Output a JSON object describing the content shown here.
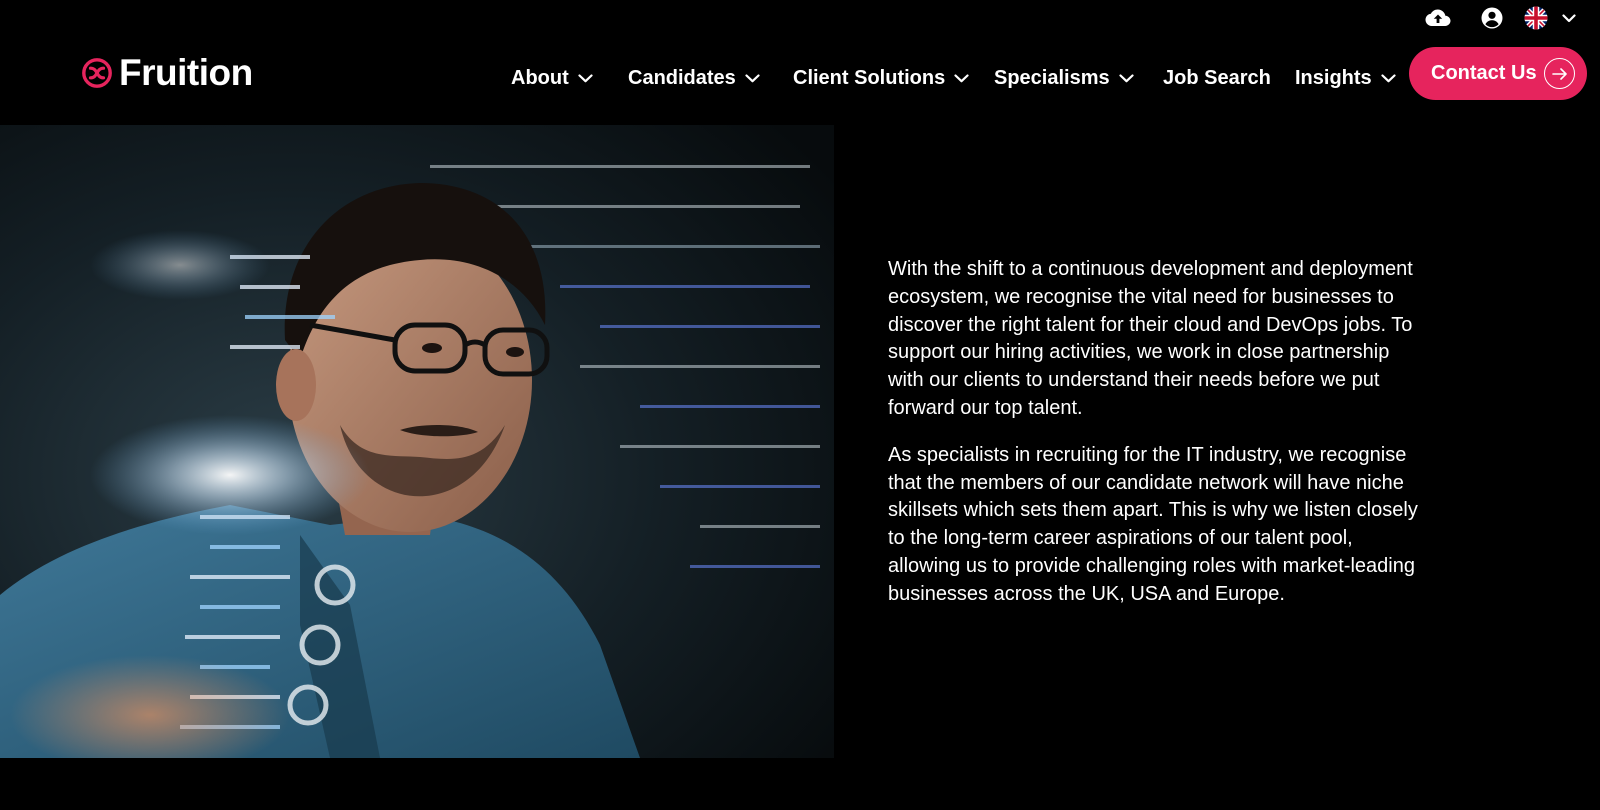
{
  "utility": {
    "icons": [
      "cloud-upload-icon",
      "account-icon",
      "uk-flag-icon",
      "chevron-down-icon"
    ]
  },
  "brand": {
    "name": "Fruition",
    "accent": "#e6245d"
  },
  "nav": {
    "items": [
      {
        "label": "About",
        "has_dropdown": true
      },
      {
        "label": "Candidates",
        "has_dropdown": true
      },
      {
        "label": "Client Solutions",
        "has_dropdown": true
      },
      {
        "label": "Specialisms",
        "has_dropdown": true
      },
      {
        "label": "Job Search",
        "has_dropdown": false
      },
      {
        "label": "Insights",
        "has_dropdown": true
      }
    ],
    "contact_label": "Contact Us"
  },
  "content": {
    "paragraphs": [
      "With the shift to a continuous development and deployment ecosystem, we recognise the vital need for businesses to discover the right talent for their cloud and DevOps jobs. To support our hiring activities, we work in close partnership with our clients to understand their needs before we put forward our top talent.",
      "As specialists in recruiting for the IT industry, we recognise that the members of our candidate network will have niche skillsets which sets them apart. This is why we listen closely to the long-term career aspirations of our talent pool, allowing us to provide challenging roles with market-leading businesses across the UK, USA and Europe."
    ]
  },
  "colors": {
    "background": "#000000",
    "text": "#ffffff",
    "button": "#e6245d"
  }
}
